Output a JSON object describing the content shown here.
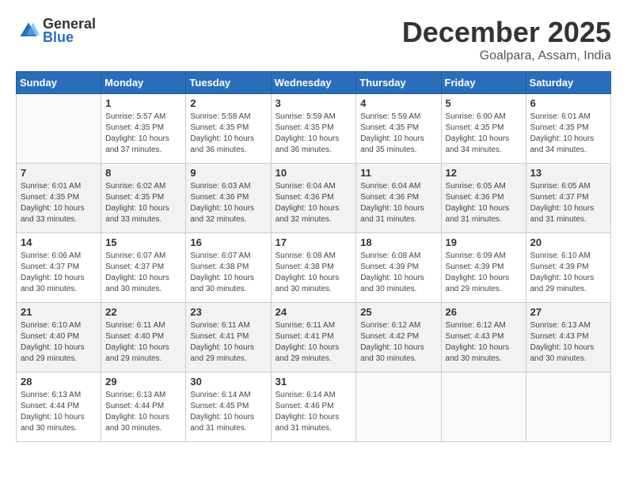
{
  "header": {
    "logo_text_general": "General",
    "logo_text_blue": "Blue",
    "month_title": "December 2025",
    "location": "Goalpara, Assam, India"
  },
  "weekdays": [
    "Sunday",
    "Monday",
    "Tuesday",
    "Wednesday",
    "Thursday",
    "Friday",
    "Saturday"
  ],
  "weeks": [
    [
      {
        "day": "",
        "info": ""
      },
      {
        "day": "1",
        "info": "Sunrise: 5:57 AM\nSunset: 4:35 PM\nDaylight: 10 hours\nand 37 minutes."
      },
      {
        "day": "2",
        "info": "Sunrise: 5:58 AM\nSunset: 4:35 PM\nDaylight: 10 hours\nand 36 minutes."
      },
      {
        "day": "3",
        "info": "Sunrise: 5:59 AM\nSunset: 4:35 PM\nDaylight: 10 hours\nand 36 minutes."
      },
      {
        "day": "4",
        "info": "Sunrise: 5:59 AM\nSunset: 4:35 PM\nDaylight: 10 hours\nand 35 minutes."
      },
      {
        "day": "5",
        "info": "Sunrise: 6:00 AM\nSunset: 4:35 PM\nDaylight: 10 hours\nand 34 minutes."
      },
      {
        "day": "6",
        "info": "Sunrise: 6:01 AM\nSunset: 4:35 PM\nDaylight: 10 hours\nand 34 minutes."
      }
    ],
    [
      {
        "day": "7",
        "info": "Sunrise: 6:01 AM\nSunset: 4:35 PM\nDaylight: 10 hours\nand 33 minutes."
      },
      {
        "day": "8",
        "info": "Sunrise: 6:02 AM\nSunset: 4:35 PM\nDaylight: 10 hours\nand 33 minutes."
      },
      {
        "day": "9",
        "info": "Sunrise: 6:03 AM\nSunset: 4:36 PM\nDaylight: 10 hours\nand 32 minutes."
      },
      {
        "day": "10",
        "info": "Sunrise: 6:04 AM\nSunset: 4:36 PM\nDaylight: 10 hours\nand 32 minutes."
      },
      {
        "day": "11",
        "info": "Sunrise: 6:04 AM\nSunset: 4:36 PM\nDaylight: 10 hours\nand 31 minutes."
      },
      {
        "day": "12",
        "info": "Sunrise: 6:05 AM\nSunset: 4:36 PM\nDaylight: 10 hours\nand 31 minutes."
      },
      {
        "day": "13",
        "info": "Sunrise: 6:05 AM\nSunset: 4:37 PM\nDaylight: 10 hours\nand 31 minutes."
      }
    ],
    [
      {
        "day": "14",
        "info": "Sunrise: 6:06 AM\nSunset: 4:37 PM\nDaylight: 10 hours\nand 30 minutes."
      },
      {
        "day": "15",
        "info": "Sunrise: 6:07 AM\nSunset: 4:37 PM\nDaylight: 10 hours\nand 30 minutes."
      },
      {
        "day": "16",
        "info": "Sunrise: 6:07 AM\nSunset: 4:38 PM\nDaylight: 10 hours\nand 30 minutes."
      },
      {
        "day": "17",
        "info": "Sunrise: 6:08 AM\nSunset: 4:38 PM\nDaylight: 10 hours\nand 30 minutes."
      },
      {
        "day": "18",
        "info": "Sunrise: 6:08 AM\nSunset: 4:39 PM\nDaylight: 10 hours\nand 30 minutes."
      },
      {
        "day": "19",
        "info": "Sunrise: 6:09 AM\nSunset: 4:39 PM\nDaylight: 10 hours\nand 29 minutes."
      },
      {
        "day": "20",
        "info": "Sunrise: 6:10 AM\nSunset: 4:39 PM\nDaylight: 10 hours\nand 29 minutes."
      }
    ],
    [
      {
        "day": "21",
        "info": "Sunrise: 6:10 AM\nSunset: 4:40 PM\nDaylight: 10 hours\nand 29 minutes."
      },
      {
        "day": "22",
        "info": "Sunrise: 6:11 AM\nSunset: 4:40 PM\nDaylight: 10 hours\nand 29 minutes."
      },
      {
        "day": "23",
        "info": "Sunrise: 6:11 AM\nSunset: 4:41 PM\nDaylight: 10 hours\nand 29 minutes."
      },
      {
        "day": "24",
        "info": "Sunrise: 6:11 AM\nSunset: 4:41 PM\nDaylight: 10 hours\nand 29 minutes."
      },
      {
        "day": "25",
        "info": "Sunrise: 6:12 AM\nSunset: 4:42 PM\nDaylight: 10 hours\nand 30 minutes."
      },
      {
        "day": "26",
        "info": "Sunrise: 6:12 AM\nSunset: 4:43 PM\nDaylight: 10 hours\nand 30 minutes."
      },
      {
        "day": "27",
        "info": "Sunrise: 6:13 AM\nSunset: 4:43 PM\nDaylight: 10 hours\nand 30 minutes."
      }
    ],
    [
      {
        "day": "28",
        "info": "Sunrise: 6:13 AM\nSunset: 4:44 PM\nDaylight: 10 hours\nand 30 minutes."
      },
      {
        "day": "29",
        "info": "Sunrise: 6:13 AM\nSunset: 4:44 PM\nDaylight: 10 hours\nand 30 minutes."
      },
      {
        "day": "30",
        "info": "Sunrise: 6:14 AM\nSunset: 4:45 PM\nDaylight: 10 hours\nand 31 minutes."
      },
      {
        "day": "31",
        "info": "Sunrise: 6:14 AM\nSunset: 4:46 PM\nDaylight: 10 hours\nand 31 minutes."
      },
      {
        "day": "",
        "info": ""
      },
      {
        "day": "",
        "info": ""
      },
      {
        "day": "",
        "info": ""
      }
    ]
  ]
}
